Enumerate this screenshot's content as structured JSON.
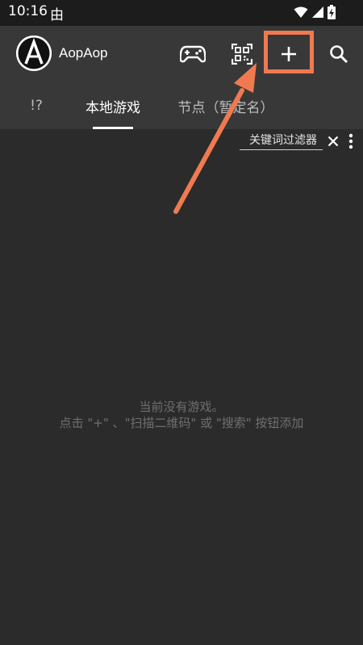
{
  "status": {
    "time": "10:16",
    "notification_glyph": "由",
    "icons": [
      "wifi-icon",
      "signal-icon",
      "battery-charging-icon"
    ]
  },
  "appbar": {
    "title": "AopAop",
    "avatar_letter": "A",
    "actions": [
      "gamepad-icon",
      "qr-scan-icon",
      "add-icon",
      "search-icon"
    ]
  },
  "tabs": [
    {
      "label": "!?"
    },
    {
      "label": "本地游戏",
      "selected": true
    },
    {
      "label": "节点（暂定名）"
    }
  ],
  "filter": {
    "placeholder": "关键词过滤器"
  },
  "empty": {
    "line1": "当前没有游戏。",
    "line2": "点击 \"+\" 、\"扫描二维码\" 或 \"搜索\" 按钮添加"
  },
  "colors": {
    "background": "#2b2b2b",
    "appbar": "#383838",
    "status_bar": "#1c1c1c",
    "annotation": "#f07a50",
    "empty_text": "#6f6f6f"
  }
}
